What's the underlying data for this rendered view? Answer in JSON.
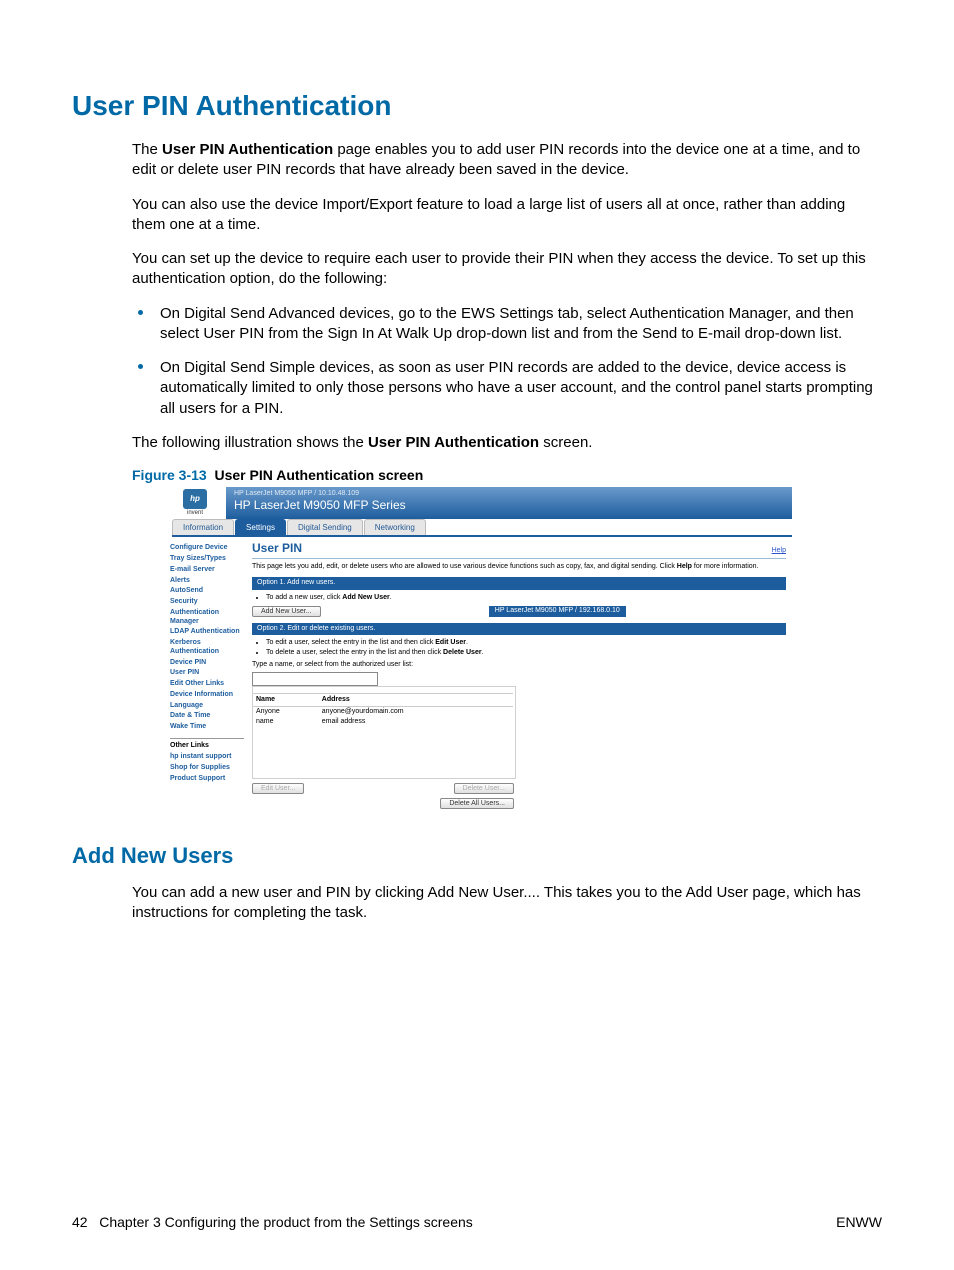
{
  "heading": "User PIN Authentication",
  "para1_prefix": "The ",
  "para1_bold": "User PIN Authentication",
  "para1_suffix": " page enables you to add user PIN records into the device one at a time, and to edit or delete user PIN records that have already been saved in the device.",
  "para2": "You can also use the device Import/Export feature to load a large list of users all at once, rather than adding them one at a time.",
  "para3": "You can set up the device to require each user to provide their PIN when they access the device. To set up this authentication option, do the following:",
  "bullets": [
    "On Digital Send Advanced devices, go to the EWS Settings tab, select Authentication Manager, and then select User PIN from the Sign In At Walk Up drop-down list and from the Send to E-mail drop-down list.",
    "On Digital Send Simple devices, as soon as user PIN records are added to the device, device access is automatically limited to only those persons who have a user account, and the control panel starts prompting all users for a PIN."
  ],
  "para4_prefix": "The following illustration shows the ",
  "para4_bold": "User PIN Authentication",
  "para4_suffix": " screen.",
  "figure_label": "Figure 3-13",
  "figure_title_bold": "User PIN Authentication",
  "figure_title_suffix": " screen",
  "ews": {
    "logo_text": "hp",
    "logo_sub": "invent",
    "banner_small": "HP LaserJet M9050 MFP / 10.10.48.109",
    "banner_title": "HP LaserJet M9050 MFP Series",
    "tabs": [
      "Information",
      "Settings",
      "Digital Sending",
      "Networking"
    ],
    "active_tab_index": 1,
    "sidebar": {
      "group1": [
        "Configure Device",
        "Tray Sizes/Types",
        "E-mail Server",
        "Alerts",
        "AutoSend",
        "Security",
        "Authentication Manager",
        "LDAP Authentication",
        "Kerberos Authentication",
        "Device PIN",
        "User PIN",
        "Edit Other Links",
        "Device Information",
        "Language",
        "Date & Time",
        "Wake Time"
      ],
      "current_index": 10,
      "other_links_header": "Other Links",
      "other_links": [
        "hp instant support",
        "Shop for Supplies",
        "Product Support"
      ]
    },
    "main": {
      "title": "User PIN",
      "help": "Help",
      "intro_prefix": "This page lets you add, edit, or delete users who are allowed to use various device functions such as copy, fax, and digital sending. Click ",
      "intro_bold": "Help",
      "intro_suffix": " for more information.",
      "option1_bar": "Option 1. Add new users.",
      "option1_li_prefix": "To add a new user, click ",
      "option1_li_bold": "Add New User",
      "option1_li_suffix": ".",
      "add_btn": "Add New User...",
      "status_bar": "HP LaserJet M9050 MFP / 192.168.0.10",
      "option2_bar": "Option 2. Edit or delete existing users.",
      "option2_li1_prefix": "To edit a user, select the entry in the list and then click ",
      "option2_li1_bold": "Edit User",
      "option2_li1_suffix": ".",
      "option2_li2_prefix": "To delete a user, select the entry in the list and then click ",
      "option2_li2_bold": "Delete User",
      "option2_li2_suffix": ".",
      "type_label": "Type a name, or select from the authorized user list:",
      "table_headers": [
        "Name",
        "Address"
      ],
      "table_rows": [
        [
          "Anyone",
          "anyone@yourdomain.com"
        ],
        [
          "name",
          "email address"
        ]
      ],
      "edit_btn": "Edit User...",
      "delete_btn": "Delete User...",
      "delete_all_btn": "Delete All Users..."
    }
  },
  "subheading": "Add New Users",
  "sub_para": "You can add a new user and PIN by clicking Add New User.... This takes you to the Add User page, which has instructions for completing the task.",
  "footer_left_page": "42",
  "footer_left_text": "Chapter 3   Configuring the product from the Settings screens",
  "footer_right": "ENWW"
}
